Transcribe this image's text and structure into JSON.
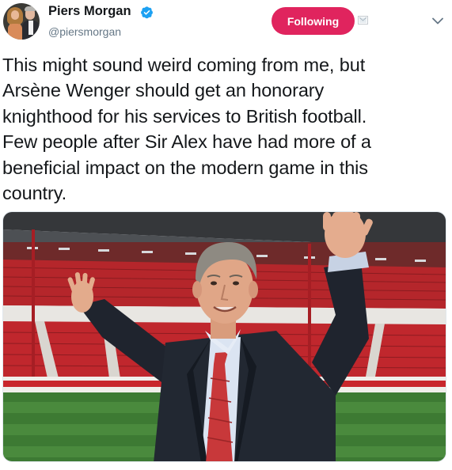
{
  "user": {
    "display_name": "Piers Morgan",
    "handle": "@piersmorgan",
    "verified": true,
    "avatar_icon": "profile-photo"
  },
  "actions": {
    "follow_label": "Following",
    "follow_color": "#e0245e",
    "dm_icon": "direct-message-icon",
    "menu_icon": "chevron-down-icon"
  },
  "tweet": {
    "lines": [
      "This might sound weird coming from me, but",
      "Arsène Wenger should get an honorary",
      "knighthood  for his services to British football.",
      "Few people after Sir Alex have had more of a",
      "beneficial impact on the modern game in this",
      "country."
    ]
  },
  "colors": {
    "text": "#14171a",
    "secondary": "#657786",
    "verified": "#1da1f2"
  }
}
